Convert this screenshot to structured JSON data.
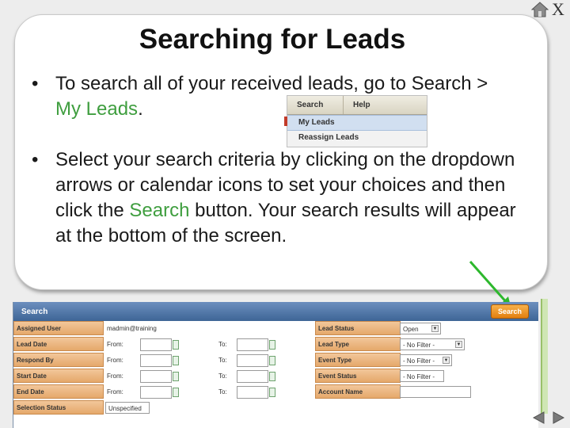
{
  "title": "Searching for Leads",
  "bullets": [
    {
      "text_before": "To search all of your received leads, go to Search > ",
      "highlight": "My Leads",
      "text_after": "."
    },
    {
      "text_before": "Select your search criteria by clicking on the dropdown arrows or calendar icons to set your choices and then click the ",
      "highlight": "Search",
      "text_after": " button. Your search results will appear at the bottom of the screen."
    }
  ],
  "bullet_char": "•",
  "close_label": "X",
  "menu": {
    "tabs": [
      "Search",
      "Help"
    ],
    "items": [
      "My Leads",
      "Reassign Leads"
    ]
  },
  "panel": {
    "header": "Search",
    "search_button": "Search",
    "left_rows": [
      {
        "label": "Assigned User",
        "value": "madmin@training"
      },
      {
        "label": "Lead Date",
        "from": "From:",
        "to": "To:"
      },
      {
        "label": "Respond By",
        "from": "From:",
        "to": "To:"
      },
      {
        "label": "Start Date",
        "from": "From:",
        "to": "To:"
      },
      {
        "label": "End Date",
        "from": "From:",
        "to": "To:"
      },
      {
        "label": "Selection Status",
        "select": "Unspecified"
      }
    ],
    "right_rows": [
      {
        "label": "Lead Status",
        "select": "Open"
      },
      {
        "label": "Lead Type",
        "select": "- No Filter -"
      },
      {
        "label": "Event Type",
        "select": "- No Filter -"
      },
      {
        "label": "Event Status",
        "select": "- No Filter -"
      },
      {
        "label": "Account Name",
        "input": ""
      }
    ]
  },
  "colors": {
    "highlight_green": "#3f9e3f",
    "panel_header": "#4a6fa0",
    "search_button": "#f0981f",
    "arrow_green": "#2db82d"
  }
}
